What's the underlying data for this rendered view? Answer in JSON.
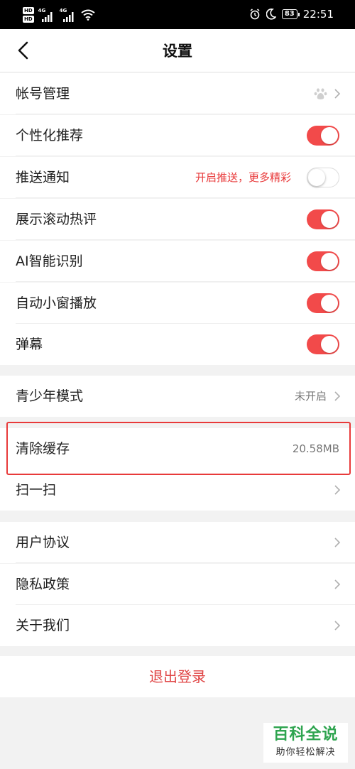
{
  "status_bar": {
    "hd_badge": "HD",
    "network_1": "4G",
    "network_2": "4G",
    "battery": "83",
    "time": "22:51"
  },
  "header": {
    "title": "设置"
  },
  "group1": {
    "account": {
      "label": "帐号管理"
    },
    "personalized": {
      "label": "个性化推荐",
      "enabled": true
    },
    "push": {
      "label": "推送通知",
      "hint": "开启推送，更多精彩",
      "enabled": false
    },
    "hot_comments": {
      "label": "展示滚动热评",
      "enabled": true
    },
    "ai": {
      "label": "AI智能识别",
      "enabled": true
    },
    "mini_window": {
      "label": "自动小窗播放",
      "enabled": true
    },
    "danmaku": {
      "label": "弹幕",
      "enabled": true
    }
  },
  "group2": {
    "youth": {
      "label": "青少年模式",
      "value": "未开启"
    }
  },
  "group3": {
    "cache": {
      "label": "清除缓存",
      "value": "20.58MB"
    },
    "scan": {
      "label": "扫一扫"
    }
  },
  "group4": {
    "agreement": {
      "label": "用户协议"
    },
    "privacy": {
      "label": "隐私政策"
    },
    "about": {
      "label": "关于我们"
    }
  },
  "logout": {
    "label": "退出登录"
  },
  "watermark": {
    "title": "百科全说",
    "subtitle": "助你轻松解决"
  },
  "colors": {
    "accent": "#f24a4a",
    "highlight_border": "#e83a3a",
    "watermark_green": "#2ea44f"
  }
}
